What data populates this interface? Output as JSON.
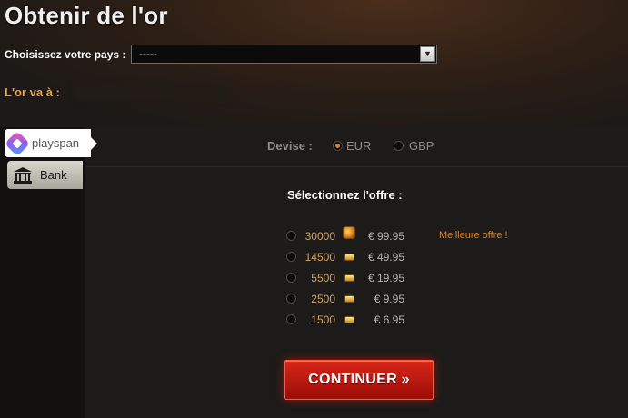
{
  "page": {
    "title": "Obtenir de l'or"
  },
  "country": {
    "label": "Choisissez votre pays :",
    "selected": "-----"
  },
  "gold_recipient": {
    "label": "L'or va à :"
  },
  "payment_tabs": [
    {
      "label": "playspan",
      "icon": "playspan-logo-icon",
      "active": true
    },
    {
      "label": "Bank",
      "icon": "bank-icon",
      "active": false
    }
  ],
  "currency": {
    "label": "Devise :",
    "options": [
      {
        "label": "EUR",
        "selected": true
      },
      {
        "label": "GBP",
        "selected": false
      }
    ]
  },
  "offers": {
    "title": "Sélectionnez l'offre :",
    "items": [
      {
        "amount": "30000",
        "price": "€ 99.95",
        "note": "Meilleure offre !"
      },
      {
        "amount": "14500",
        "price": "€ 49.95",
        "note": ""
      },
      {
        "amount": "5500",
        "price": "€ 19.95",
        "note": ""
      },
      {
        "amount": "2500",
        "price": "€ 9.95",
        "note": ""
      },
      {
        "amount": "1500",
        "price": "€ 6.95",
        "note": ""
      }
    ]
  },
  "actions": {
    "continue_label": "CONTINUER »"
  },
  "colors": {
    "accent": "#d9832f",
    "gold_text": "#d2a463",
    "button": "#c81e12"
  }
}
